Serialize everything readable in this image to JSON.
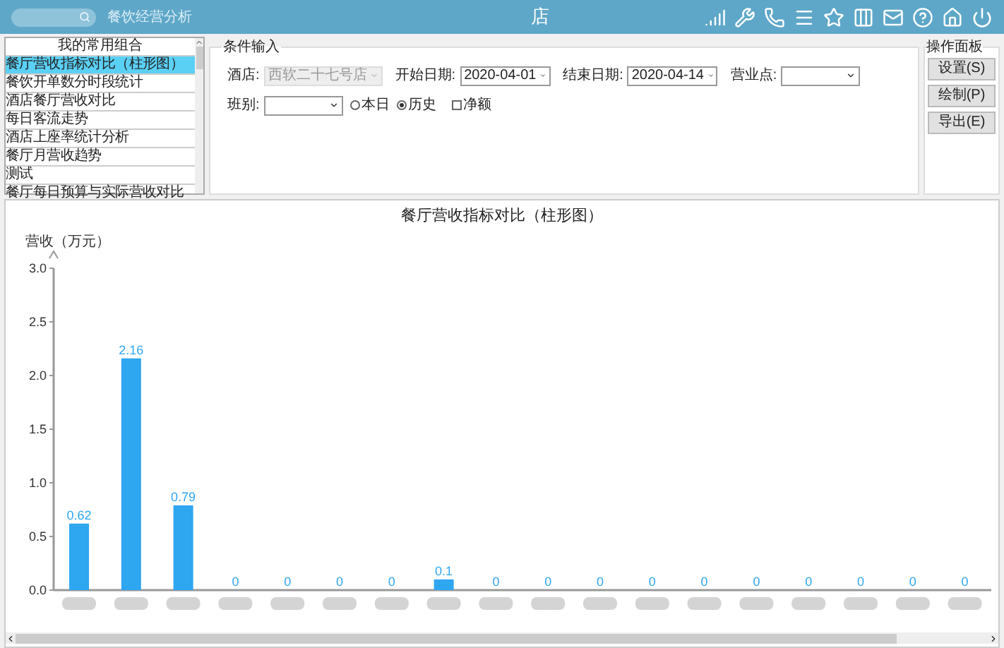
{
  "top_bar": {
    "module": "餐饮经营分析",
    "title": "店"
  },
  "favorites": {
    "title": "我的常用组合",
    "items": [
      {
        "label": "餐厅营收指标对比（柱形图）",
        "selected": true
      },
      {
        "label": "餐饮开单数分时段统计",
        "selected": false
      },
      {
        "label": "酒店餐厅营收对比",
        "selected": false
      },
      {
        "label": "每日客流走势",
        "selected": false
      },
      {
        "label": "酒店上座率统计分析",
        "selected": false
      },
      {
        "label": "餐厅月营收趋势",
        "selected": false
      },
      {
        "label": "测试",
        "selected": false
      },
      {
        "label": "餐厅每日预算与实际营收对比",
        "selected": false
      }
    ]
  },
  "conditions": {
    "title": "条件输入",
    "fields": [
      {
        "label": "酒店:",
        "value": "西软二十七号店",
        "disabled": true
      },
      {
        "label": "开始日期:",
        "value": "2020-04-01",
        "disabled": false
      },
      {
        "label": "结束日期:",
        "value": "2020-04-14",
        "disabled": false
      },
      {
        "label": "营业点:",
        "disabled": false
      },
      {
        "label": "班别:",
        "disabled": false
      }
    ],
    "radios": [
      {
        "label": "本日",
        "selected": false
      },
      {
        "label": "历史",
        "selected": true
      }
    ],
    "checkbox": {
      "label": "净额",
      "checked": false
    }
  },
  "operations": {
    "title": "操作面板",
    "buttons": [
      "设置(S)",
      "绘制(P)",
      "导出(E)"
    ]
  },
  "chart": {
    "chart_data": {
      "type": "bar",
      "title": "餐厅营收指标对比（柱形图）",
      "ylabel": "营收（万元）",
      "series": [
        {
          "color": "#2ea6f0",
          "values": [
            0.62,
            2.16,
            0.79,
            0,
            0,
            0,
            0,
            0.1,
            0,
            0,
            0,
            0,
            0,
            0,
            0,
            0,
            0,
            0
          ]
        }
      ],
      "ylim": [
        0,
        3
      ],
      "yticks": [
        {
          "value": 0,
          "label": "0.0"
        },
        {
          "value": 0.5,
          "label": "0.5"
        },
        {
          "value": 1,
          "label": "1.0"
        },
        {
          "value": 1.5,
          "label": "1.5"
        },
        {
          "value": 2,
          "label": "2.0"
        },
        {
          "value": 2.5,
          "label": "2.5"
        },
        {
          "value": 3,
          "label": "3.0"
        }
      ],
      "data_labels": true
    }
  }
}
